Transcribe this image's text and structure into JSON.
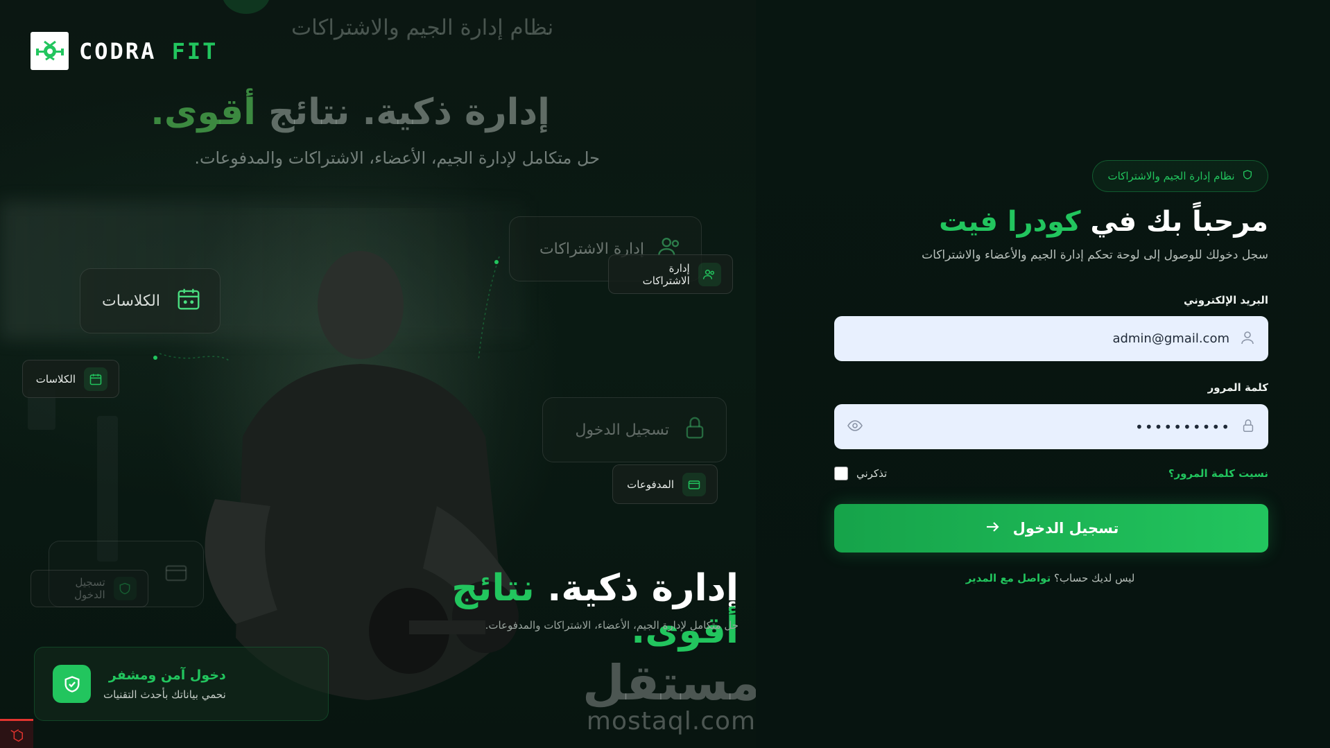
{
  "brand": {
    "name_part1": "CODRA",
    "name_part2": "FIT"
  },
  "hero": {
    "ghost_subtitle": "نظام إدارة الجيم والاشتراكات",
    "ghost_heading_part1": "إدارة ذكية. نتائج ",
    "ghost_heading_part2": "أقوى.",
    "ghost_desc": "حل متكامل لإدارة الجيم، الأعضاء، الاشتراكات والمدفوعات.",
    "heading_part1": "إدارة ذكية. ",
    "heading_part2": "نتائج أقوى",
    "heading_dot": ".",
    "desc": "حل متكامل لإدارة الجيم، الأعضاء، الاشتراكات والمدفوعات."
  },
  "cards": {
    "big_classes": "الكلاسات",
    "big_subscriptions": "إدارة الاشتراكات",
    "big_login": "تسجيل الدخول",
    "chip_subscriptions": "إدارة الاشتراكات",
    "chip_classes": "الكلاسات",
    "chip_payments": "المدفوعات",
    "chip_login": "تسجيل الدخول"
  },
  "secure": {
    "title": "دخول آمن ومشفر",
    "subtitle": "نحمي بياناتك بأحدث التقنيات"
  },
  "watermark": {
    "arabic": "مستقل",
    "latin": "mostaql.com"
  },
  "login": {
    "badge": "نظام إدارة الجيم والاشتراكات",
    "welcome_part1": "مرحباً بك في ",
    "welcome_part2": "كودرا فيت",
    "welcome_sub": "سجل دخولك للوصول إلى لوحة تحكم إدارة الجيم والأعضاء والاشتراكات",
    "email_label": "البريد الإلكتروني",
    "email_value": "admin@gmail.com",
    "password_label": "كلمة المرور",
    "password_value": "••••••••••",
    "remember_label": "تذكرني",
    "forgot_label": "نسيت كلمة المرور؟",
    "submit_label": "تسجيل الدخول",
    "no_account": "ليس لديك حساب؟ ",
    "contact_admin": "تواصل مع المدير"
  },
  "colors": {
    "accent": "#22c55e",
    "background": "#071410",
    "input_bg": "#e8f0fe"
  },
  "icons": [
    "shield-icon",
    "calendar-icon",
    "users-icon",
    "lock-icon",
    "credit-card-icon",
    "user-icon",
    "eye-icon",
    "arrow-right-icon",
    "laravel-icon"
  ]
}
